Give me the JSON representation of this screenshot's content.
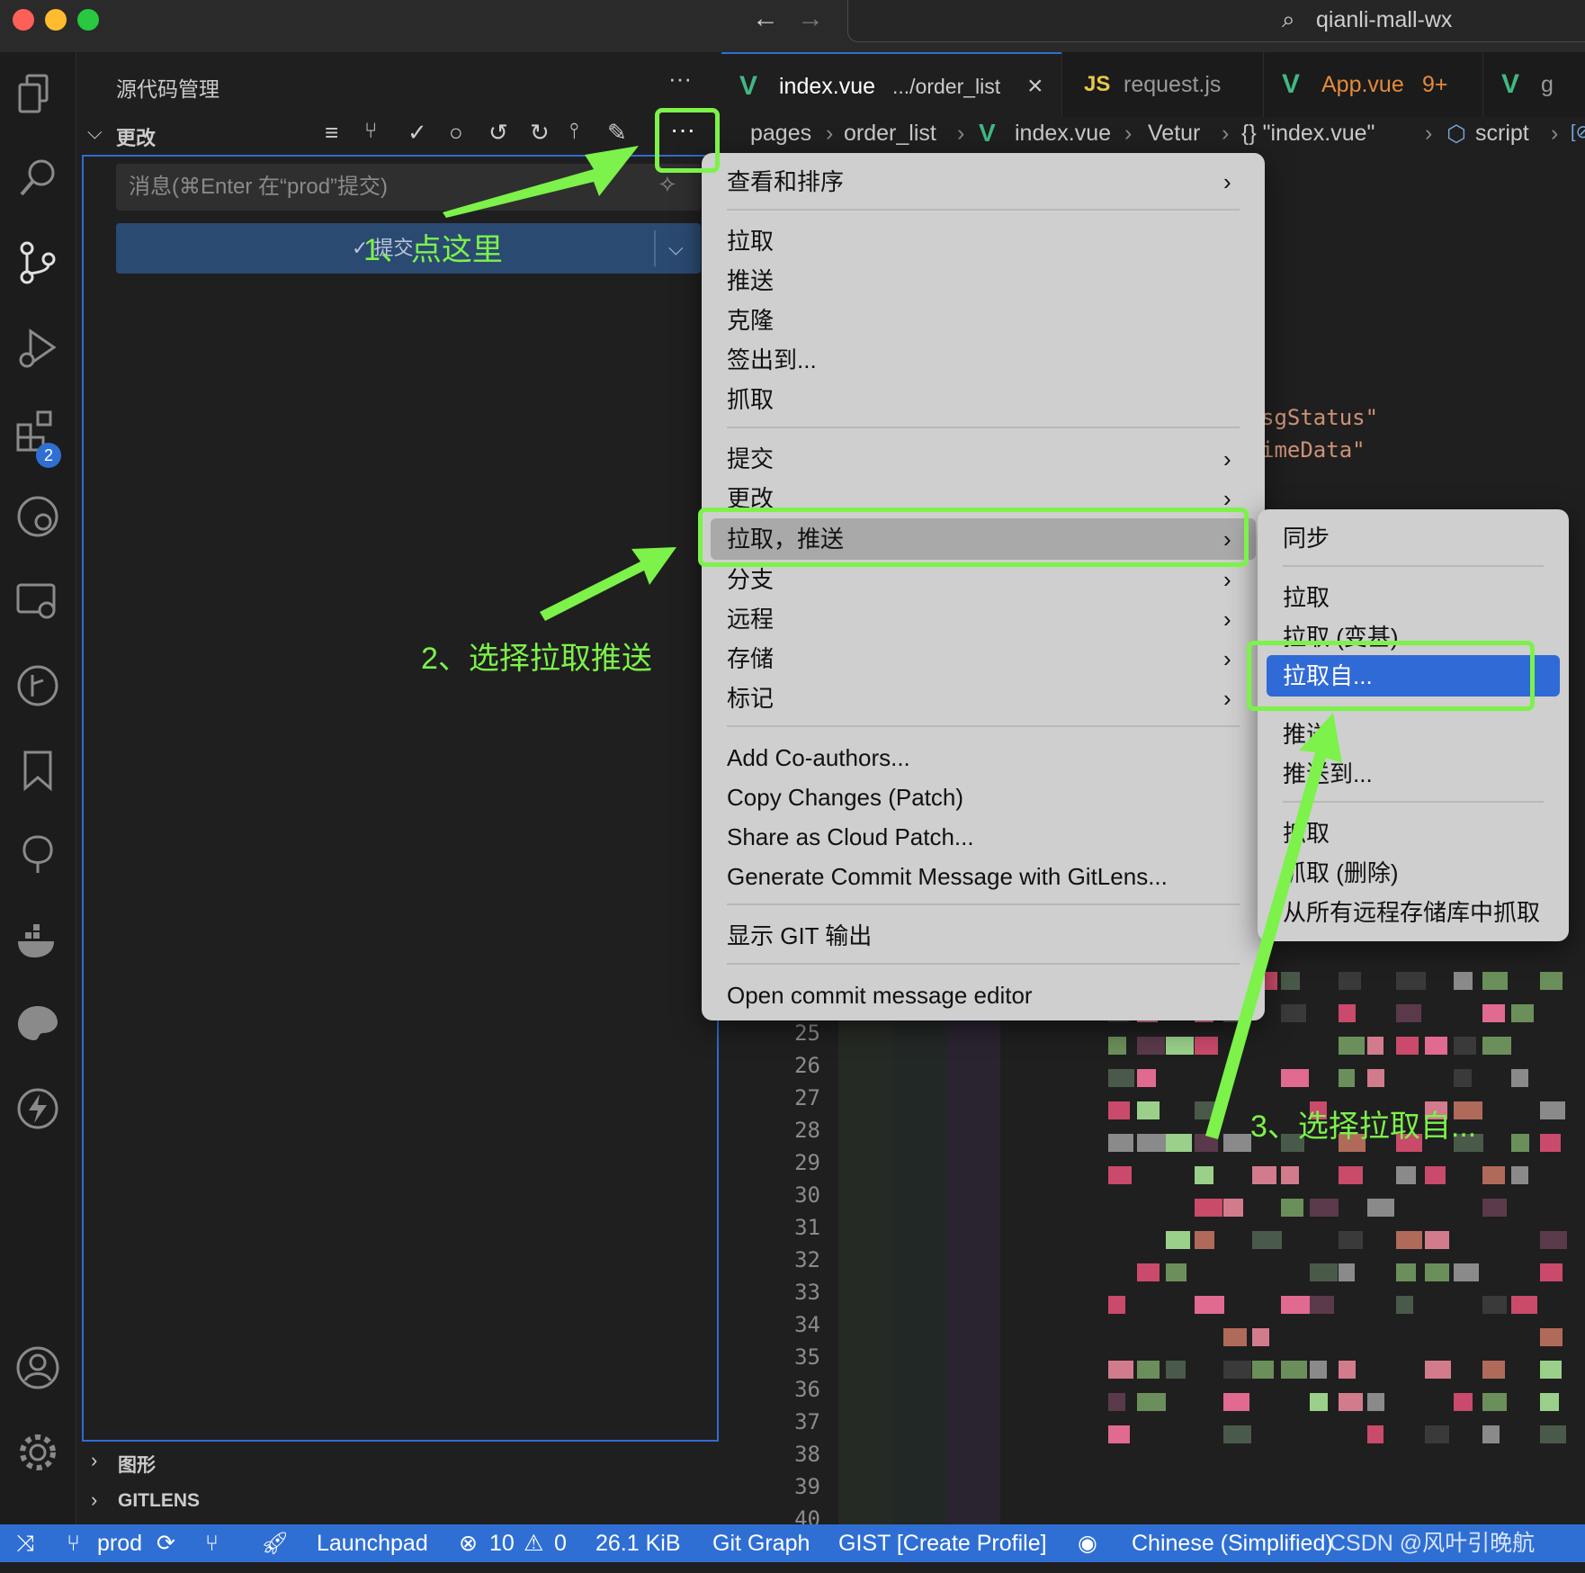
{
  "window": {
    "search_text": "qianli-mall-wx"
  },
  "sidebar": {
    "title": "源代码管理",
    "more_label": "···",
    "changes_label": "更改",
    "message_placeholder": "消息(⌘Enter 在“prod”提交)",
    "commit_label": "✓ 提交",
    "sections": [
      "图形",
      "GITLENS"
    ]
  },
  "tabs": [
    {
      "icon": "V",
      "label": "index.vue",
      "detail": ".../order_list",
      "close": "×"
    },
    {
      "icon": "JS",
      "label": "request.js"
    },
    {
      "icon": "V",
      "label": "App.vue",
      "badge": "9+"
    },
    {
      "icon": "V",
      "label": "g"
    }
  ],
  "breadcrumb": [
    "pages",
    "order_list",
    "index.vue",
    "Vetur",
    "{} \"index.vue\"",
    "script",
    "[⊘]"
  ],
  "code_fragments": [
    "sgStatus\"",
    "imeData\""
  ],
  "line_numbers": [
    "25",
    "26",
    "27",
    "28",
    "29",
    "30",
    "31",
    "32",
    "33",
    "34",
    "35",
    "36",
    "37",
    "38",
    "39",
    "40"
  ],
  "menu": {
    "items": [
      "查看和排序",
      "拉取",
      "推送",
      "克隆",
      "签出到...",
      "抓取",
      "提交",
      "更改",
      "拉取，推送",
      "分支",
      "远程",
      "存储",
      "标记",
      "Add Co-authors...",
      "Copy Changes (Patch)",
      "Share as Cloud Patch...",
      "Generate Commit Message with GitLens...",
      "显示 GIT 输出",
      "Open commit message editor"
    ]
  },
  "submenu": {
    "items": [
      "同步",
      "拉取",
      "拉取 (变基)",
      "拉取自...",
      "推送",
      "推送到...",
      "抓取",
      "抓取 (删除)",
      "从所有远程存储库中抓取"
    ]
  },
  "annotations": [
    "1、点这里",
    "2、选择拉取推送",
    "3、选择拉取自..."
  ],
  "statusbar": {
    "branch": "prod",
    "launchpad": "Launchpad",
    "errors": "10",
    "warnings": "0",
    "size": "26.1 KiB",
    "git_graph": "Git Graph",
    "gist": "GIST [Create Profile]",
    "language": "Chinese (Simplified)",
    "watermark": "CSDN @风叶引晚航"
  },
  "activity_badge": "2",
  "colors": {
    "accent": "#2f6fd4",
    "annotation": "#7cf24a",
    "menu_highlight": "#2f6ad6"
  }
}
